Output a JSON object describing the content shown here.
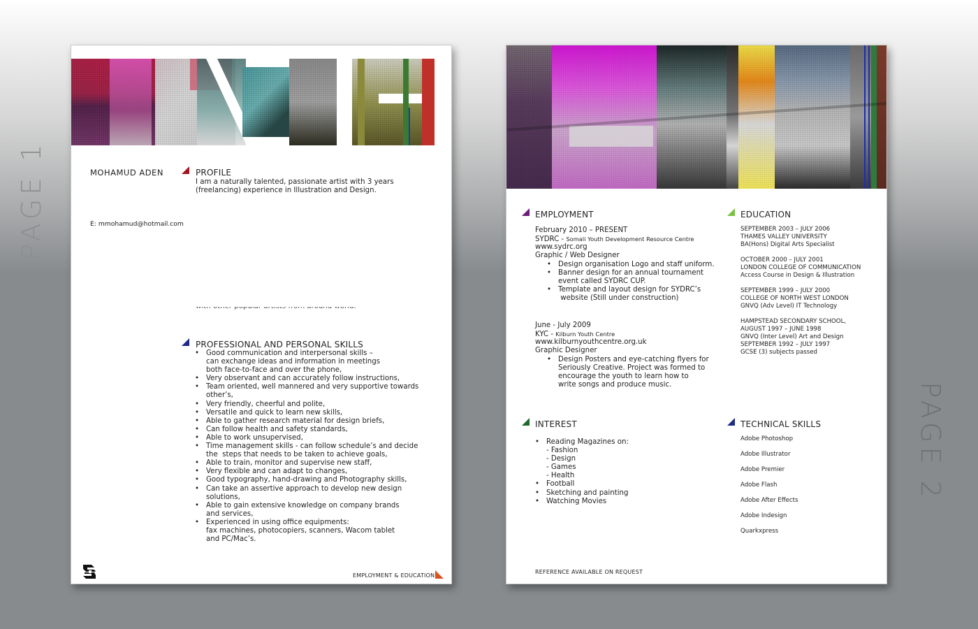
{
  "side_labels": {
    "page1": "PAGE 1",
    "page2": "PAGE 2"
  },
  "colors": {
    "profile_marker": "#a3161f",
    "skills_marker": "#1d2a86",
    "employment_marker": "#6c1c7a",
    "education_marker": "#7ac142",
    "interest_marker": "#1e6a2e",
    "technical_marker": "#1d2a86",
    "footer_marker": "#d9531e"
  },
  "page1": {
    "name": "MOHAMUD ADEN",
    "contact": {
      "phone_obscured": "",
      "email": "E: mmohamud@hotmail.com"
    },
    "profile": {
      "heading": "PROFILE",
      "lines": [
        "I am a naturally talented, passionate artist with 3 years",
        "(freelancing) experience in Illustration and Design."
      ],
      "clipped_line": "with other popular artists from around world."
    },
    "skills": {
      "heading": "PROFESSIONAL AND PERSONAL SKILLS",
      "items": [
        "Good communication and interpersonal skills –\ncan exchange ideas and information in meetings\nboth face-to-face and over the phone,",
        "Very observant and can accurately follow instructions,",
        "Team oriented, well mannered and very supportive towards\nother’s,",
        "Very friendly, cheerful and polite,",
        "Versatile and quick to learn new skills,",
        "Able to gather research material for design briefs,",
        "Can follow health and safety standards,",
        "Able to work unsupervised,",
        "Time management skills - can follow schedule’s and decide\nthe  steps that needs to be taken to achieve goals,",
        "Able to train, monitor and supervise new staff,",
        "Very flexible and can adapt to changes,",
        "Good typography, hand-drawing and Photography skills,",
        "Can take an assertive approach to develop new design\nsolutions,",
        "Able to gain extensive knowledge on company brands\nand services,",
        "Experienced in using office equipments:\nfax machines, photocopiers, scanners, Wacom tablet\nand PC/Mac’s."
      ]
    },
    "footer": {
      "next_label": "EMPLOYMENT & EDUCATION",
      "logo": "SA-monogram-logo"
    }
  },
  "page2": {
    "employment": {
      "heading": "EMPLOYMENT",
      "jobs": [
        {
          "dates": "February 2010 – PRESENT",
          "org_short": "SYDRC - ",
          "org_full": "Somali Youth Development Resource Centre",
          "url": "www.sydrc.org",
          "role": "Graphic / Web Designer",
          "duties": [
            "Design organisation Logo and staff uniform.",
            "Banner design for an annual tournament\nevent called SYDRC CUP.",
            "Template and layout design for SYDRC’s\n website (Still under construction)"
          ]
        },
        {
          "dates": "June - July 2009",
          "org_short": "KYC - ",
          "org_full": "Kilburn Youth Centre",
          "url": "www.kilburnyouthcentre.org.uk",
          "role": "Graphic Designer",
          "duties": [
            "Design Posters and eye-catching flyers for\nSeriously Creative. Project was formed to\nencourage the youth to learn how to\nwrite songs and produce music."
          ]
        }
      ]
    },
    "education": {
      "heading": "EDUCATION",
      "entries": [
        [
          "SEPTEMBER 2003 – JULY 2006",
          "THAMES VALLEY UNIVERSITY",
          "BA(Hons) Digital Arts Specialist"
        ],
        [
          "OCTOBER 2000 – JULY 2001",
          "LONDON COLLEGE OF COMMUNICATION",
          "Access Course in Design & Illustration"
        ],
        [
          "SEPTEMBER 1999 – JULY 2000",
          "COLLEGE OF NORTH WEST LONDON",
          "GNVQ (Adv Level) IT Technology"
        ],
        [
          "HAMPSTEAD SECONDARY SCHOOL,",
          "AUGUST 1997 – JUNE 1998",
          "GNVQ (Inter Level) Art and Design",
          "SEPTEMBER 1992 – JULY 1997",
          "GCSE (3) subjects passed"
        ]
      ]
    },
    "interest": {
      "heading": "INTEREST",
      "items": [
        "Reading Magazines on:\n- Fashion\n- Design\n- Games\n- Health",
        "Football",
        "Sketching and painting",
        "Watching Movies"
      ]
    },
    "technical": {
      "heading": "TECHNICAL SKILLS",
      "items": [
        "Adobe Photoshop",
        "Adobe Illustrator",
        "Adobe Premier",
        "Adobe Flash",
        "Adobe After Effects",
        "Adobe Indesign",
        "Quarkxpress"
      ]
    },
    "footer": {
      "reference": "REFERENCE AVAILABLE ON REQUEST"
    }
  }
}
